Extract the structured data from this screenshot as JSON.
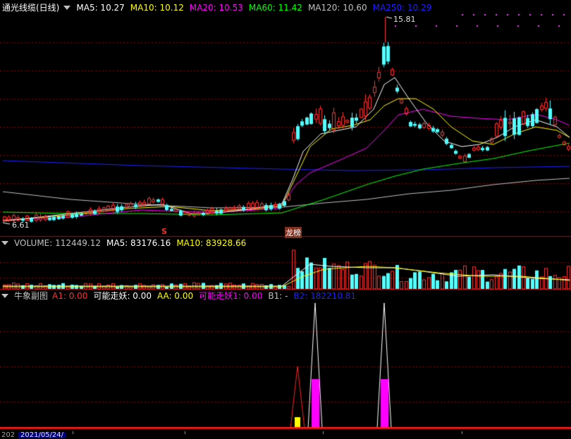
{
  "main_header": {
    "title": "通光线缆(日线)",
    "items": [
      {
        "label": "MA5: 10.27",
        "color": "#ffffff"
      },
      {
        "label": "MA10: 10.12",
        "color": "#ffff00"
      },
      {
        "label": "MA20: 10.53",
        "color": "#ff00ff"
      },
      {
        "label": "MA60: 11.42",
        "color": "#00ff00"
      },
      {
        "label": "MA120: 10.60",
        "color": "#c0c0c0"
      },
      {
        "label": "MA250: 10.29",
        "color": "#2020ff"
      }
    ]
  },
  "volume_header": {
    "items": [
      {
        "label": "VOLUME: 112449.12",
        "color": "#c0c0c0"
      },
      {
        "label": "MA5: 83176.16",
        "color": "#ffffff"
      },
      {
        "label": "MA10: 83928.66",
        "color": "#ffff00"
      }
    ]
  },
  "indicator_header": {
    "title": "牛象副图",
    "items": [
      {
        "label": "A1: 0.00",
        "color": "#ff3030"
      },
      {
        "label": "可能走妖: 0.00",
        "color": "#ffffff"
      },
      {
        "label": "AA: 0.00",
        "color": "#ffff00"
      },
      {
        "label": "可能走妖1: 0.00",
        "color": "#ff00ff"
      },
      {
        "label": "B1: -",
        "color": "#c0c0c0"
      },
      {
        "label": "B2: 182210.81",
        "color": "#2020ff"
      }
    ]
  },
  "price_marks": {
    "high_label": "15.81",
    "low_label": "6.61"
  },
  "markers": {
    "s_label": "S",
    "dragon_label": "龙榜"
  },
  "footer": {
    "date": "2021/05/24/",
    "left_axis": "202"
  },
  "colors": {
    "up": "#ff3232",
    "down": "#54ffff",
    "grid": "#800000",
    "ma5": "#ffffff",
    "ma10": "#ffff00",
    "ma20": "#ff00ff",
    "ma60": "#00ff00",
    "ma120": "#c0c0c0",
    "ma250": "#2020ff"
  }
}
